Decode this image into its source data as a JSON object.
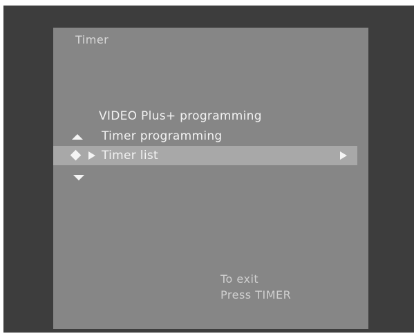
{
  "screen": {
    "title": "Timer"
  },
  "menu": {
    "items": [
      {
        "label": "VIDEO Plus+ programming",
        "selected": false
      },
      {
        "label": "Timer programming",
        "selected": false
      },
      {
        "label": "Timer list",
        "selected": true,
        "has_submenu": true
      }
    ]
  },
  "hint": {
    "line1": "To exit",
    "line2": "Press TIMER"
  },
  "colors": {
    "bezel": "#3d3d3d",
    "screen_background": "#868686",
    "highlight_bar": "#a8a8a8",
    "text": "#f2f2f2"
  },
  "icons": {
    "scroll_up": "triangle-up",
    "scroll_down": "triangle-down",
    "selection_marker": "diamond",
    "cursor": "triangle-right",
    "submenu": "triangle-right"
  }
}
